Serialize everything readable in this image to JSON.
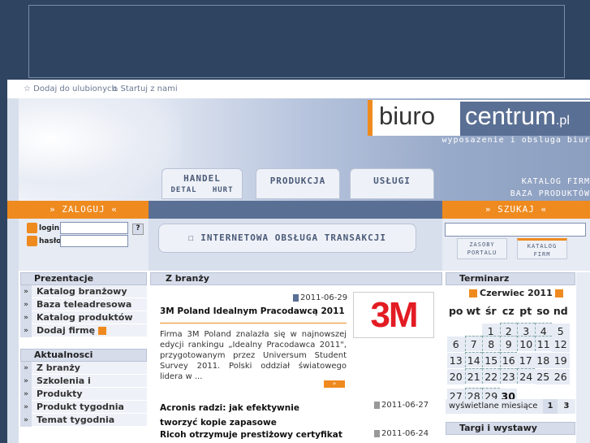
{
  "toplinks": {
    "fav": "Dodaj do ulubionych",
    "start": "Startuj z nami"
  },
  "logo": {
    "part1": "biuro",
    "part2": "centrum",
    "tld": ".pl",
    "tagline": "wyposazenie i obsluga biur"
  },
  "nav": [
    {
      "l1": "HANDEL",
      "l2": "DETAL   HURT"
    },
    {
      "l1": "PRODUKCJA",
      "l2": ""
    },
    {
      "l1": "USŁUGI",
      "l2": ""
    }
  ],
  "katalog": {
    "l1": "KATALOG FIRM",
    "l2": "BAZA PRODUKTÓW"
  },
  "bars": {
    "login": "» ZALOGUJ «",
    "search": "» SZUKAJ «"
  },
  "login": {
    "login_label": "login",
    "haslo_label": "hasło",
    "help": "?"
  },
  "transakcje": "☐ INTERNETOWA OBSŁUGA TRANSAKCJI",
  "searchtabs": [
    {
      "l1": "ZASOBY",
      "l2": "PORTALU"
    },
    {
      "l1": "KATALOG",
      "l2": "FIRM"
    }
  ],
  "prezentacje": {
    "title": "Prezentacje",
    "items": [
      "Katalog branżowy",
      "Baza teleadresowa",
      "Katalog produktów",
      "Dodaj firmę"
    ]
  },
  "aktualnosci": {
    "title": "Aktualnosci",
    "items": [
      "Z branży",
      "Szkolenia i konferencje",
      "Produkty",
      "Produkt tygodnia",
      "Temat tygodnia"
    ]
  },
  "news": {
    "title": "Z branży",
    "main": {
      "date": "2011-06-29",
      "headline": "3M Poland Idealnym Pracodawcą 2011",
      "body": "Firma 3M Poland znalazła się w najnowszej edycji rankingu „Idealny Pracodawca 2011\", przygotowanym przez Universum Student Survey 2011. Polski oddział światowego lidera w ...",
      "logo": "3M",
      "more": "»"
    },
    "items": [
      {
        "headline": "Acronis radzi: jak efektywnie tworzyć kopie zapasowe",
        "date": "2011-06-27"
      },
      {
        "headline": "Ricoh otrzymuje prestiżowy certyfikat",
        "date": "2011-06-24"
      }
    ]
  },
  "terminarz": {
    "title": "Terminarz",
    "month": "Czerwiec 2011",
    "days": [
      "po",
      "wt",
      "śr",
      "cz",
      "pt",
      "so",
      "nd"
    ],
    "weeks": [
      [
        "",
        "",
        "1",
        "2",
        "3",
        "4",
        "5"
      ],
      [
        "6",
        "7",
        "8",
        "9",
        "10",
        "11",
        "12"
      ],
      [
        "13",
        "14",
        "15",
        "16",
        "17",
        "18",
        "19"
      ],
      [
        "20",
        "21",
        "22",
        "23",
        "24",
        "25",
        "26"
      ],
      [
        "27",
        "28",
        "29",
        "30",
        "",
        "",
        ""
      ]
    ],
    "wyswietlane": "wyświetlane miesiące",
    "pages": [
      "1",
      "3"
    ],
    "targi": "Targi i wystawy"
  },
  "colors": {
    "accent": "#ef8a1e",
    "navy": "#2f4460",
    "slate": "#5a6f94"
  }
}
